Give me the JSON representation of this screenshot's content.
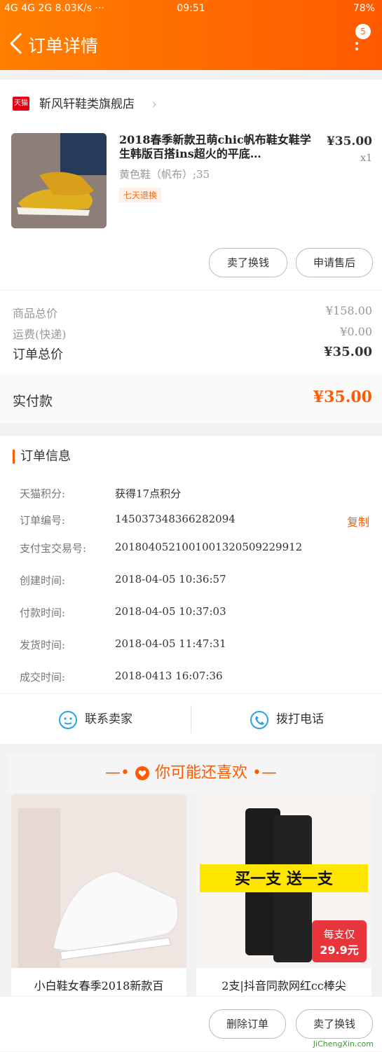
{
  "status_bar": {
    "left": "4G 4G 2G 8.03K/s ···",
    "time": "09:51",
    "battery": "78%"
  },
  "header": {
    "title": "订单详情",
    "badge_count": "5"
  },
  "store": {
    "tmall_label": "天猫",
    "name": "靳风轩鞋类旗舰店"
  },
  "product": {
    "title": "2018春季新款丑萌chic帆布鞋女鞋学生韩版百搭ins超火的平底…",
    "price": "¥35.00",
    "qty": "x1",
    "spec": "黄色鞋（帆布）;35",
    "tag": "七天退换"
  },
  "actions": {
    "sell": "卖了换钱",
    "aftersale": "申请售后"
  },
  "summary": {
    "goods_label": "商品总价",
    "goods_value": "¥158.00",
    "shipping_label": "运费(快递)",
    "shipping_value": "¥0.00",
    "total_label": "订单总价",
    "total_value": "¥35.00",
    "paid_label": "实付款",
    "paid_value": "¥35.00"
  },
  "order_info": {
    "title": "订单信息",
    "rows": [
      {
        "k": "天猫积分:",
        "v": "获得17点积分"
      },
      {
        "k": "订单编号:",
        "v": "145037348366282094"
      },
      {
        "k": "支付宝交易号:",
        "v": "2018040521001001320509229912"
      },
      {
        "k": "创建时间:",
        "v": "2018-04-05 10:36:57"
      },
      {
        "k": "付款时间:",
        "v": "2018-04-05 10:37:03"
      },
      {
        "k": "发货时间:",
        "v": "2018-04-05 11:47:31"
      },
      {
        "k": "成交时间:",
        "v": "2018-0413 16:07:36"
      }
    ],
    "copy": "复制"
  },
  "contact": {
    "seller": "联系卖家",
    "call": "拨打电话"
  },
  "recommend": {
    "title": "你可能还喜欢",
    "items": [
      {
        "caption": "小白鞋女春季2018新款百"
      },
      {
        "caption": "2支|抖音同款网红cc棒尖",
        "promo_text": "买一支 送一支",
        "price_tag_1": "每支仅",
        "price_tag_2": "29.9元"
      }
    ]
  },
  "bottom": {
    "delete": "删除订单",
    "sell": "卖了换钱"
  },
  "watermark": "JiChengXin.com",
  "colors": {
    "accent": "#ff5a00"
  }
}
